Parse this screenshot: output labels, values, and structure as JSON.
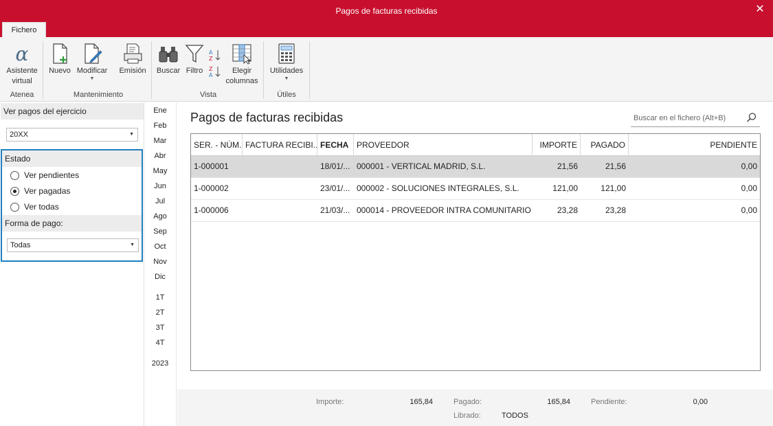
{
  "window": {
    "title": "Pagos de facturas recibidas",
    "close_glyph": "✕"
  },
  "tabs": [
    {
      "label": "Fichero"
    }
  ],
  "ribbon": {
    "buttons": {
      "asistente": {
        "label_line1": "Asistente",
        "label_line2": "virtual",
        "icon": "alpha-icon"
      },
      "nuevo": {
        "label": "Nuevo",
        "icon": "new-document-icon"
      },
      "modificar": {
        "label": "Modificar",
        "icon": "edit-document-icon"
      },
      "emision": {
        "label": "Emisión",
        "icon": "print-icon"
      },
      "buscar": {
        "label": "Buscar",
        "icon": "binoculars-icon"
      },
      "filtro": {
        "label": "Filtro",
        "icon": "filter-icon"
      },
      "elegir": {
        "label_line1": "Elegir",
        "label_line2": "columnas",
        "icon": "columns-icon"
      },
      "utilidades": {
        "label": "Utilidades",
        "icon": "calculator-icon"
      }
    },
    "groups": {
      "atenea": "Atenea",
      "mantenimiento": "Mantenimiento",
      "vista": "Vista",
      "utiles": "Útiles"
    },
    "accent_color": "#c8102e"
  },
  "left_panel": {
    "ejercicio_label": "Ver pagos del ejercicio",
    "ejercicio_value": "20XX",
    "estado_label": "Estado",
    "options": [
      {
        "label": "Ver pendientes",
        "selected": false
      },
      {
        "label": "Ver pagadas",
        "selected": true
      },
      {
        "label": "Ver todas",
        "selected": false
      }
    ],
    "forma_pago_label": "Forma de pago:",
    "forma_pago_value": "Todas"
  },
  "periods": {
    "months": [
      "Ene",
      "Feb",
      "Mar",
      "Abr",
      "May",
      "Jun",
      "Jul",
      "Ago",
      "Sep",
      "Oct",
      "Nov",
      "Dic"
    ],
    "quarters": [
      "1T",
      "2T",
      "3T",
      "4T"
    ],
    "year": "2023"
  },
  "main": {
    "title": "Pagos de facturas recibidas",
    "search_placeholder": "Buscar en el fichero (Alt+B)"
  },
  "table": {
    "columns": [
      "SER. - NÚM.",
      "FACTURA RECIBI...",
      "FECHA",
      "PROVEEDOR",
      "IMPORTE",
      "PAGADO",
      "PENDIENTE"
    ],
    "rows": [
      {
        "ser_num": "1-000001",
        "factura": "",
        "fecha": "18/01/...",
        "proveedor": "000001 - VERTICAL MADRID, S.L.",
        "importe": "21,56",
        "pagado": "21,56",
        "pendiente": "0,00",
        "selected": true
      },
      {
        "ser_num": "1-000002",
        "factura": "",
        "fecha": "23/01/...",
        "proveedor": "000002 - SOLUCIONES INTEGRALES, S.L.",
        "importe": "121,00",
        "pagado": "121,00",
        "pendiente": "0,00",
        "selected": false
      },
      {
        "ser_num": "1-000006",
        "factura": "",
        "fecha": "21/03/...",
        "proveedor": "000014 - PROVEEDOR INTRA COMUNITARIO",
        "importe": "23,28",
        "pagado": "23,28",
        "pendiente": "0,00",
        "selected": false
      }
    ]
  },
  "footer": {
    "importe_label": "Importe:",
    "importe_value": "165,84",
    "pagado_label": "Pagado:",
    "pagado_value": "165,84",
    "pendiente_label": "Pendiente:",
    "pendiente_value": "0,00",
    "librado_label": "Librado:",
    "librado_value": "TODOS"
  }
}
